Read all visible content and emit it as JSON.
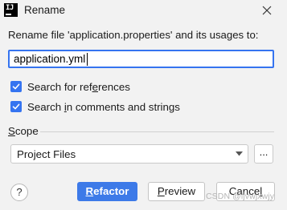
{
  "window": {
    "title": "Rename",
    "app_icon_text": "IJ"
  },
  "form": {
    "rename_label": "Rename file 'application.properties' and its usages to:",
    "new_name_value": "application.yml"
  },
  "options": {
    "search_references": {
      "label_pre": "Search for ref",
      "label_mnemonic": "e",
      "label_post": "rences",
      "checked": true
    },
    "search_comments": {
      "label_pre": "Search ",
      "label_mnemonic": "i",
      "label_post": "n comments and strings",
      "checked": true
    }
  },
  "scope": {
    "label_mnemonic": "S",
    "label_rest": "cope",
    "selected": "Project Files",
    "browse_label": "..."
  },
  "buttons": {
    "help": "?",
    "refactor_mnemonic": "R",
    "refactor_rest": "efactor",
    "preview_mnemonic": "P",
    "preview_rest": "review",
    "cancel_pre": "Cance",
    "cancel_post": "l"
  },
  "watermark": "CSDN @ljvwjxwjy",
  "colors": {
    "accent": "#3574f0",
    "primary_button": "#3d7ae8",
    "background": "#f2f2f2"
  }
}
